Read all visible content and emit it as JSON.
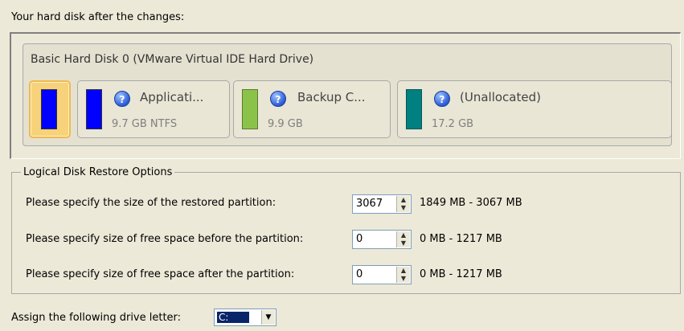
{
  "header": {
    "label": "Your hard disk after the changes:"
  },
  "disk": {
    "title": "Basic Hard Disk 0 (VMware Virtual IDE Hard Drive)",
    "partitions": [
      {
        "name": "Applicati...",
        "size": "9.7 GB NTFS",
        "color": "#0000FF"
      },
      {
        "name": "Backup C...",
        "size": "9.9 GB",
        "color": "#8BC34A"
      },
      {
        "name": "(Unallocated)",
        "size": "17.2 GB",
        "color": "#008080"
      }
    ],
    "selected_color": "#0000FF"
  },
  "options": {
    "group_title": "Logical Disk Restore Options",
    "rows": [
      {
        "label": "Please specify the size of the restored partition:",
        "value": "3067",
        "range": "1849 MB - 3067 MB"
      },
      {
        "label": "Please specify size of free space before the partition:",
        "value": "0",
        "range": "0 MB - 1217 MB"
      },
      {
        "label": "Please specify size of free space after the partition:",
        "value": "0",
        "range": "0 MB - 1217 MB"
      }
    ]
  },
  "drive": {
    "label": "Assign the following drive letter:",
    "value": "C:"
  }
}
